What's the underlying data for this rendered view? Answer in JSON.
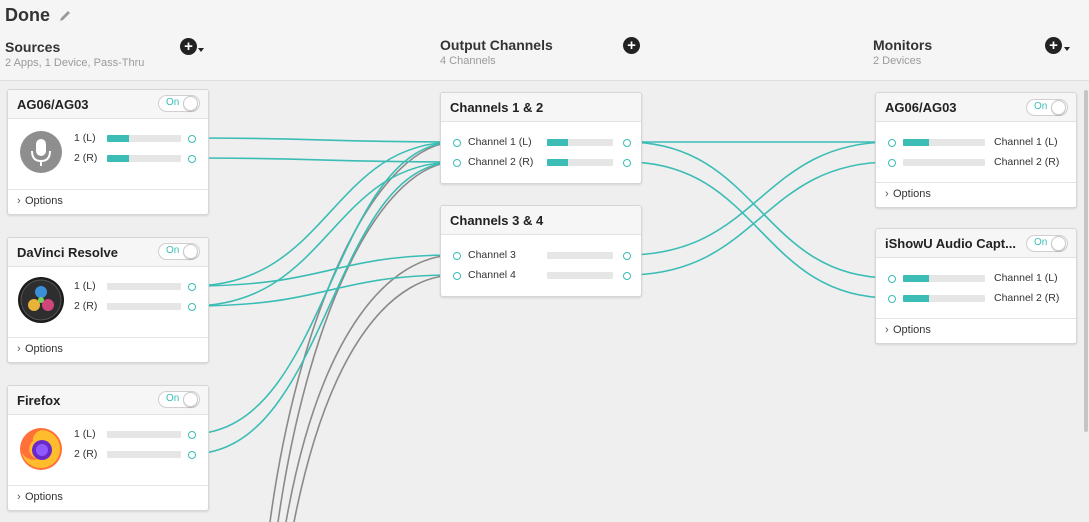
{
  "header": {
    "title": "Done"
  },
  "columns": {
    "sources": {
      "title": "Sources",
      "subtitle": "2 Apps, 1 Device, Pass-Thru"
    },
    "output": {
      "title": "Output Channels",
      "subtitle": "4 Channels"
    },
    "monitors": {
      "title": "Monitors",
      "subtitle": "2 Devices"
    }
  },
  "toggle_label": "On",
  "options_label": "Options",
  "sources": [
    {
      "name": "AG06/AG03",
      "icon": "microphone-icon",
      "channels": [
        {
          "label": "1 (L)",
          "level": 0.3
        },
        {
          "label": "2 (R)",
          "level": 0.3
        }
      ]
    },
    {
      "name": "DaVinci Resolve",
      "icon": "davinci-resolve-icon",
      "channels": [
        {
          "label": "1 (L)",
          "level": 0
        },
        {
          "label": "2 (R)",
          "level": 0
        }
      ]
    },
    {
      "name": "Firefox",
      "icon": "firefox-icon",
      "channels": [
        {
          "label": "1 (L)",
          "level": 0
        },
        {
          "label": "2 (R)",
          "level": 0
        }
      ]
    }
  ],
  "outputs": [
    {
      "name": "Channels 1 & 2",
      "channels": [
        {
          "label": "Channel 1 (L)",
          "level": 0.32
        },
        {
          "label": "Channel 2 (R)",
          "level": 0.32
        }
      ]
    },
    {
      "name": "Channels 3 & 4",
      "channels": [
        {
          "label": "Channel 3",
          "level": 0
        },
        {
          "label": "Channel 4",
          "level": 0
        }
      ]
    }
  ],
  "monitors": [
    {
      "name": "AG06/AG03",
      "channels": [
        {
          "label": "Channel 1 (L)",
          "level": 0.32
        },
        {
          "label": "Channel 2 (R)",
          "level": 0
        }
      ]
    },
    {
      "name": "iShowU Audio Capt...",
      "channels": [
        {
          "label": "Channel 1 (L)",
          "level": 0.32
        },
        {
          "label": "Channel 2 (R)",
          "level": 0.32
        }
      ]
    }
  ],
  "colors": {
    "accent": "#3bbdb5",
    "wire_inactive": "#8a8a8a"
  }
}
